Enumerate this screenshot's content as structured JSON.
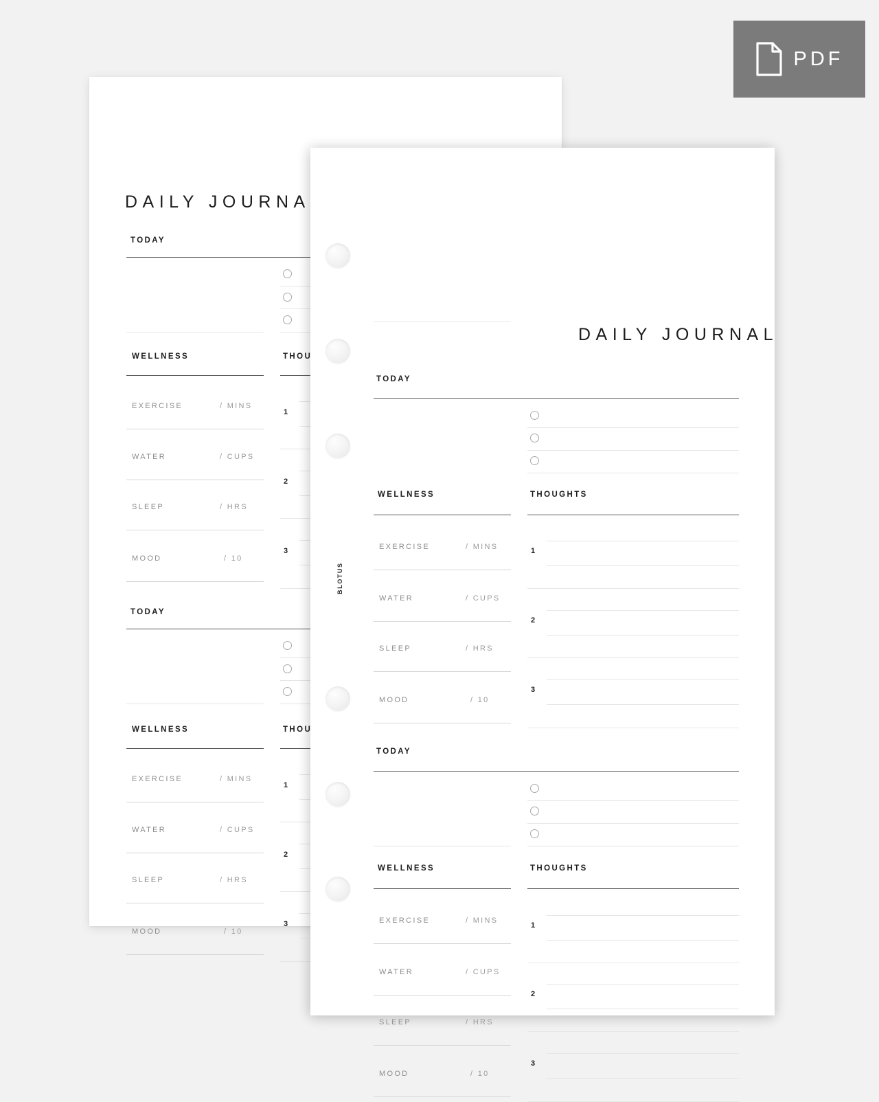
{
  "badge": {
    "label": "PDF",
    "icon": "pdf-document-icon",
    "bg_color": "#7b7b7b",
    "text_color": "#ffffff"
  },
  "canvas": {
    "background_color": "#f2f2f2",
    "page_color": "#ffffff"
  },
  "brand": {
    "vertical_text": "BLOTUS"
  },
  "page": {
    "title": "DAILY JOURNAL",
    "sections": {
      "today_label": "TODAY",
      "wellness_label": "WELLNESS",
      "thoughts_label": "THOUGHTS"
    },
    "wellness_metrics": [
      {
        "name": "EXERCISE",
        "unit": "/ MINS"
      },
      {
        "name": "WATER",
        "unit": "/ CUPS"
      },
      {
        "name": "SLEEP",
        "unit": "/ HRS"
      },
      {
        "name": "MOOD",
        "unit": "/ 10"
      }
    ],
    "thought_numbers": [
      "1",
      "2",
      "3"
    ],
    "today_checkbox_count": 3,
    "halves_per_page": 2
  },
  "sheets": [
    {
      "name": "back-sheet",
      "title": "DAILY JOURNAL"
    },
    {
      "name": "front-sheet",
      "title": "DAILY JOURNAL"
    }
  ],
  "front_sheet": {
    "punch_count": 6,
    "title": "DAILY JOURNAL",
    "half_a": {
      "today_label": "TODAY",
      "wellness_label": "WELLNESS",
      "thoughts_label": "THOUGHTS",
      "metrics": [
        {
          "name": "EXERCISE",
          "unit": "/ MINS"
        },
        {
          "name": "WATER",
          "unit": "/ CUPS"
        },
        {
          "name": "SLEEP",
          "unit": "/ HRS"
        },
        {
          "name": "MOOD",
          "unit": "/ 10"
        }
      ],
      "numbers": [
        "1",
        "2",
        "3"
      ]
    },
    "half_b": {
      "today_label": "TODAY",
      "wellness_label": "WELLNESS",
      "thoughts_label": "THOUGHTS",
      "metrics": [
        {
          "name": "EXERCISE",
          "unit": "/ MINS"
        },
        {
          "name": "WATER",
          "unit": "/ CUPS"
        },
        {
          "name": "SLEEP",
          "unit": "/ HRS"
        },
        {
          "name": "MOOD",
          "unit": "/ 10"
        }
      ],
      "numbers": [
        "1",
        "2",
        "3"
      ]
    }
  },
  "back_sheet": {
    "title": "DAILY JOURNAL",
    "half_a": {
      "today_label": "TODAY",
      "wellness_label": "WELLNESS",
      "thoughts_label": "THOU",
      "metrics": [
        {
          "name": "EXERCISE",
          "unit": "/ MINS"
        },
        {
          "name": "WATER",
          "unit": "/ CUPS"
        },
        {
          "name": "SLEEP",
          "unit": "/ HRS"
        },
        {
          "name": "MOOD",
          "unit": "/ 10"
        }
      ],
      "numbers": [
        "1",
        "2",
        "3"
      ]
    },
    "half_b": {
      "today_label": "TODAY",
      "wellness_label": "WELLNESS",
      "thoughts_label": "THOU",
      "metrics": [
        {
          "name": "EXERCISE",
          "unit": "/ MINS"
        },
        {
          "name": "WATER",
          "unit": "/ CUPS"
        },
        {
          "name": "SLEEP",
          "unit": "/ HRS"
        },
        {
          "name": "MOOD",
          "unit": "/ 10"
        }
      ],
      "numbers": [
        "1",
        "2",
        "3"
      ]
    }
  }
}
